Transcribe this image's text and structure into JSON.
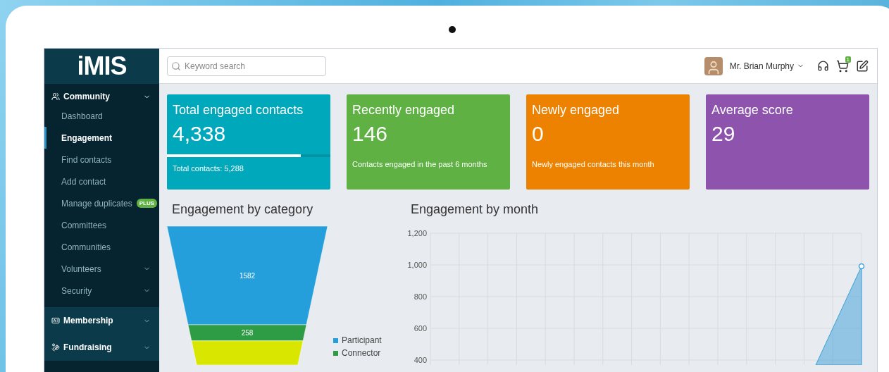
{
  "sidebar": {
    "logo": "iMIS",
    "sections": [
      {
        "label": "Community",
        "expanded": true,
        "items": [
          {
            "label": "Dashboard",
            "selected": false,
            "expandable": false
          },
          {
            "label": "Engagement",
            "selected": true,
            "expandable": false
          },
          {
            "label": "Find contacts",
            "selected": false,
            "expandable": false
          },
          {
            "label": "Add contact",
            "selected": false,
            "expandable": false
          },
          {
            "label": "Manage duplicates",
            "selected": false,
            "expandable": false,
            "badge": "PLUS"
          },
          {
            "label": "Committees",
            "selected": false,
            "expandable": false
          },
          {
            "label": "Communities",
            "selected": false,
            "expandable": false
          },
          {
            "label": "Volunteers",
            "selected": false,
            "expandable": true
          },
          {
            "label": "Security",
            "selected": false,
            "expandable": true
          }
        ]
      },
      {
        "label": "Membership",
        "expanded": false
      },
      {
        "label": "Fundraising",
        "expanded": false
      }
    ]
  },
  "topbar": {
    "search": {
      "placeholder": "Keyword search"
    },
    "user": "Mr. Brian Murphy",
    "cart_count": "1"
  },
  "cards": [
    {
      "title": "Total engaged contacts",
      "value": "4,338",
      "footer": "Total contacts: 5,288",
      "color": "#00a8bc",
      "level": 0.82
    },
    {
      "title": "Recently engaged",
      "value": "146",
      "footer": "Contacts engaged in the past 6 months",
      "color": "#5eb142"
    },
    {
      "title": "Newly engaged",
      "value": "0",
      "footer": "Newly engaged contacts this month",
      "color": "#ec8200"
    },
    {
      "title": "Average score",
      "value": "29",
      "color": "#8e54ad"
    }
  ],
  "category_panel": {
    "title": "Engagement by category",
    "funnel": [
      {
        "name": "Participant",
        "value": "1582",
        "color": "#249fdb"
      },
      {
        "name": "Connector",
        "value": "258",
        "color": "#2e9b45"
      },
      {
        "color": "#d9e600"
      }
    ]
  },
  "month_panel": {
    "title": "Engagement by month",
    "y_axis_labels": [
      "1,200",
      "1,000",
      "800",
      "600",
      "400"
    ]
  }
}
